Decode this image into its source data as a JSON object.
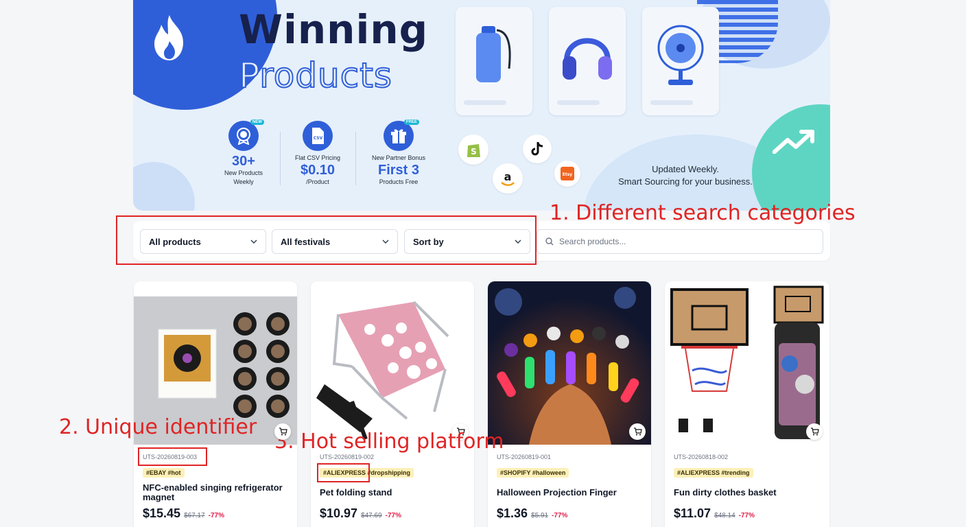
{
  "banner": {
    "title": "Winning",
    "subtitle": "Products",
    "stats": [
      {
        "badge": "NEW",
        "big": "30+",
        "line1": "New Products",
        "line2": "Weekly",
        "top": ""
      },
      {
        "badge": "",
        "top": "Flat CSV Pricing",
        "big": "$0.10",
        "line1": "/Product",
        "line2": ""
      },
      {
        "badge": "FREE",
        "top": "New Partner Bonus",
        "big": "First 3",
        "line1": "Products Free",
        "line2": ""
      }
    ],
    "csv_label": "CSV",
    "tagline_1": "Updated Weekly.",
    "tagline_2": "Smart Sourcing for your business.",
    "platforms": [
      "shopify-icon",
      "tiktok-icon",
      "amazon-icon",
      "etsy-icon"
    ],
    "etsy_label": "Etsy"
  },
  "filters": {
    "products_select": "All products",
    "festivals_select": "All festivals",
    "sort_select": "Sort by",
    "search_placeholder": "Search products..."
  },
  "products": [
    {
      "id": "UTS-20260819-003",
      "tags": "#EBAY #hot",
      "name": "NFC-enabled singing refrigerator magnet",
      "price": "$15.45",
      "old_price": "$67.17",
      "discount": "-77%"
    },
    {
      "id": "UTS-20260819-002",
      "tags": "#ALIEXPRESS #dropshipping",
      "name": "Pet folding stand",
      "price": "$10.97",
      "old_price": "$47.69",
      "discount": "-77%"
    },
    {
      "id": "UTS-20260819-001",
      "tags": "#SHOPIFY #halloween",
      "name": "Halloween Projection Finger",
      "price": "$1.36",
      "old_price": "$5.91",
      "discount": "-77%"
    },
    {
      "id": "UTS-20260818-002",
      "tags": "#ALIEXPRESS #trending",
      "name": "Fun dirty clothes basket",
      "price": "$11.07",
      "old_price": "$48.14",
      "discount": "-77%"
    }
  ],
  "annotations": {
    "one": "1.  Different search categories",
    "two": "2. Unique identifier",
    "three": "3. Hot selling platform"
  },
  "colors": {
    "accent": "#2f5fd8",
    "annotation": "#e02424",
    "discount": "#e11d48",
    "tag_bg": "#fdf0b8"
  }
}
